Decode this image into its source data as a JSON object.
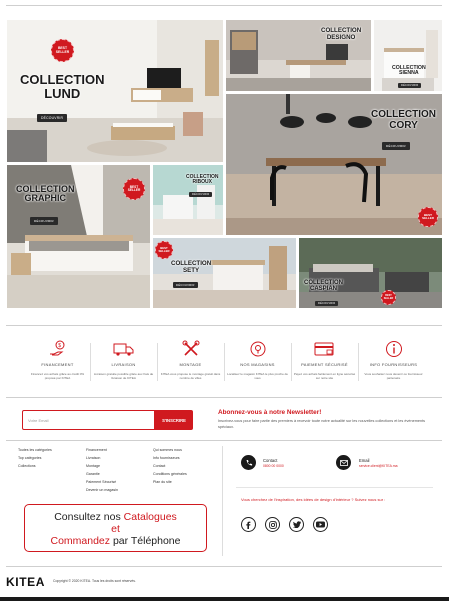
{
  "collections": [
    {
      "id": "lund",
      "title_l1": "COLLECTION",
      "title_l2": "LUND",
      "button": "DÉCOUVRIR",
      "badge": "BEST SELLER"
    },
    {
      "id": "designo",
      "title_l1": "COLLECTION",
      "title_l2": "DESIGNO"
    },
    {
      "id": "sienna",
      "title_l1": "COLLECTION",
      "title_l2": "SIENNA",
      "button": "DÉCOUVRIR"
    },
    {
      "id": "cory",
      "title_l1": "COLLECTION",
      "title_l2": "CORY",
      "button": "DÉCOUVRIR",
      "badge": "BEST SELLER"
    },
    {
      "id": "graphic",
      "title_l1": "COLLECTION",
      "title_l2": "GRAPHIC",
      "button": "DÉCOUVRIR",
      "badge": "BEST SELLER"
    },
    {
      "id": "ribdux",
      "title_l1": "COLLECTION",
      "title_l2": "RIBOUX",
      "button": "DÉCOUVRIR"
    },
    {
      "id": "sety",
      "title_l1": "COLLECTION",
      "title_l2": "SETY",
      "button": "DÉCOUVRIR",
      "badge": "BEST SELLER"
    },
    {
      "id": "caspian",
      "title_l1": "COLLECTION",
      "title_l2": "CASPIAN",
      "button": "DÉCOUVRIR",
      "badge": "BEST SELLER"
    }
  ],
  "services": [
    {
      "icon": "hand-money-icon",
      "title": "FINANCEMENT",
      "desc": "Financez vos achats grâce au crédit 0% proposé par KITEA"
    },
    {
      "icon": "delivery-truck-icon",
      "title": "LIVRAISON",
      "desc": "Livraison gratuite possible grâce aux frais de livraison de KITEA"
    },
    {
      "icon": "tools-icon",
      "title": "MONTAGE",
      "desc": "KITEA vous propose le montage gratuit dans nombre de villes"
    },
    {
      "icon": "store-location-icon",
      "title": "NOS MAGASINS",
      "desc": "Localisez le magasin KITEA le plus proche de vous"
    },
    {
      "icon": "secure-card-icon",
      "title": "PAIEMENT SÉCURISÉ",
      "desc": "Payez vos achats facilement en ligne sécurisé sur notre site"
    },
    {
      "icon": "info-icon",
      "title": "INFO FOURNISSEURS",
      "desc": "Vous souhaitez nous devenir ou fournisseur partenaire"
    }
  ],
  "newsletter": {
    "placeholder": "Votre Email",
    "button": "S'INSCRIRE",
    "title": "Abonnez-vous à notre Newsletter!",
    "text": "Inscrivez-vous pour faire partie des premiers à recevoir toute notre actualité sur les nouvelles collections et les événements spéciaux."
  },
  "footer_links": {
    "col1": [
      "Toutes les catégories",
      "Top catégories",
      "Collections"
    ],
    "col2": [
      "Financement",
      "Livraison",
      "Montage",
      "Garantie",
      "Paiement Sécurisé",
      "Devenir un magasin"
    ],
    "col3": [
      "Qui sommes nous",
      "Info fournisseurs",
      "Contact",
      "Conditions générales",
      "Plan du site"
    ]
  },
  "catalog": {
    "l1_a": "Consultez nos ",
    "l1_b": "Catalogues",
    "l2": "et",
    "l3_a": "Commandez",
    "l3_b": " par Téléphone"
  },
  "contact": {
    "phone_label": "Contact",
    "phone_value": "0800 00 0000",
    "email_label": "Email",
    "email_value": "service.client@KITEA.ma",
    "inspiration": "Vous cherchez de l'inspiration, des idées de design d'intérieur ? Suivez nous sur :"
  },
  "social": [
    "facebook-icon",
    "instagram-icon",
    "twitter-icon",
    "youtube-icon"
  ],
  "brand": {
    "logo": "KITEA",
    "copyright": "Copyright © 2020 KITEA. Tous les droits sont réservés.",
    "accent": "#d0191f"
  }
}
